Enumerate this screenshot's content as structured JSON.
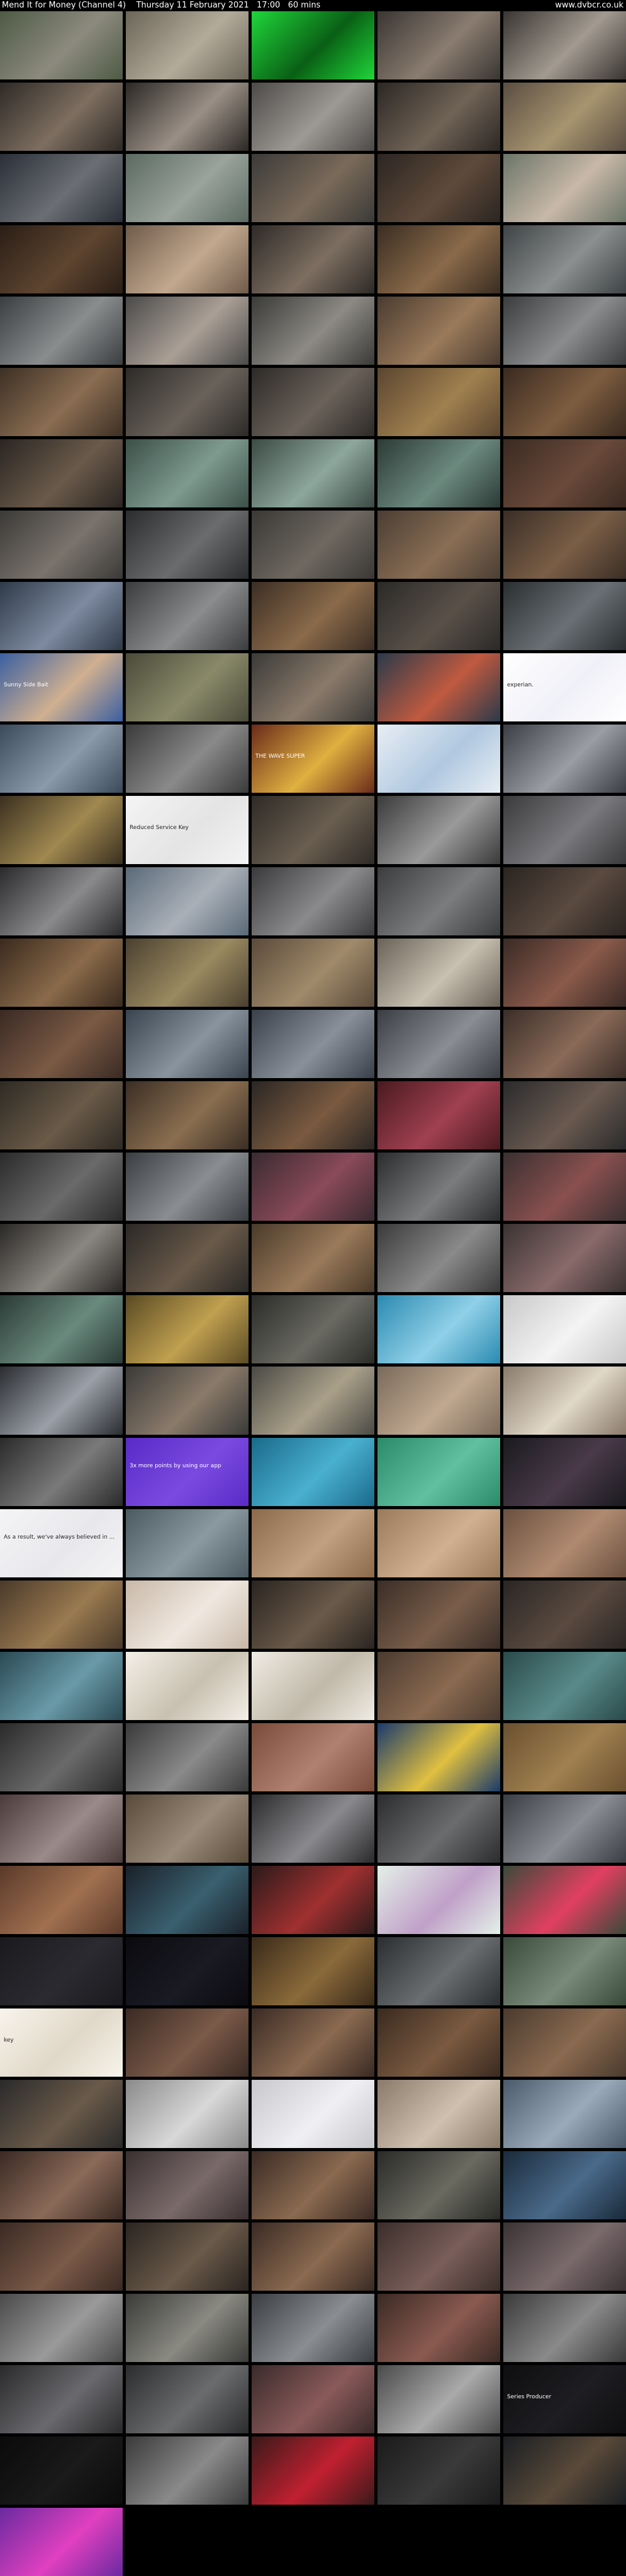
{
  "header": {
    "title": "Mend It for Money (Channel 4)",
    "date": "Thursday 11 February 2021",
    "time": "17:00",
    "duration": "60 mins",
    "site": "www.dvbcr.co.uk"
  },
  "thumbs": [
    {
      "c": [
        "#4e5a45",
        "#8c8a7e"
      ]
    },
    {
      "c": [
        "#6b6558",
        "#b3ab9a"
      ]
    },
    {
      "c": [
        "#1fd63a",
        "#0a5f15"
      ]
    },
    {
      "c": [
        "#3a3633",
        "#8a7c70"
      ]
    },
    {
      "c": [
        "#3a3532",
        "#a29a90"
      ]
    },
    {
      "c": [
        "#2f2a26",
        "#7d6e60"
      ]
    },
    {
      "c": [
        "#2b2824",
        "#9a8f86"
      ]
    },
    {
      "c": [
        "#4c4a48",
        "#9d9994"
      ]
    },
    {
      "c": [
        "#2c2724",
        "#706356"
      ]
    },
    {
      "c": [
        "#5a4e42",
        "#a7946f"
      ]
    },
    {
      "c": [
        "#2a2f38",
        "#6b6e73"
      ]
    },
    {
      "c": [
        "#5b6a62",
        "#9aa39c"
      ]
    },
    {
      "c": [
        "#3b3a38",
        "#7a6a5a"
      ]
    },
    {
      "c": [
        "#2b2522",
        "#5e4a3a"
      ]
    },
    {
      "c": [
        "#6b7569",
        "#c8b8a8"
      ]
    },
    {
      "c": [
        "#2a1e16",
        "#5e4530"
      ]
    },
    {
      "c": [
        "#6f5b4a",
        "#c2a88f"
      ]
    },
    {
      "c": [
        "#2e2a27",
        "#7d6e61"
      ]
    },
    {
      "c": [
        "#3a2d22",
        "#8a6a4a"
      ]
    },
    {
      "c": [
        "#3e4345",
        "#8c8f8f"
      ]
    },
    {
      "c": [
        "#3b3e40",
        "#8a8d8e"
      ]
    },
    {
      "c": [
        "#4a4a4a",
        "#aa9f95"
      ]
    },
    {
      "c": [
        "#3a3a38",
        "#8d8a84"
      ]
    },
    {
      "c": [
        "#4a3b30",
        "#9a7a5a"
      ]
    },
    {
      "c": [
        "#3a3c3e",
        "#8a8c8e"
      ]
    },
    {
      "c": [
        "#3d3025",
        "#8a6d52"
      ]
    },
    {
      "c": [
        "#2c2a28",
        "#6a625a"
      ]
    },
    {
      "c": [
        "#2d2a27",
        "#6b625a"
      ]
    },
    {
      "c": [
        "#5a4530",
        "#a0804f"
      ]
    },
    {
      "c": [
        "#3a2a20",
        "#7d5d40"
      ]
    },
    {
      "c": [
        "#2a2522",
        "#6a5a4a"
      ]
    },
    {
      "c": [
        "#3b5048",
        "#7e9a8f"
      ]
    },
    {
      "c": [
        "#3b4a44",
        "#8da79c"
      ]
    },
    {
      "c": [
        "#2c3a35",
        "#6c8a7f"
      ]
    },
    {
      "c": [
        "#3a2a22",
        "#6a4a3a"
      ]
    },
    {
      "c": [
        "#3b3a38",
        "#7a736c"
      ]
    },
    {
      "c": [
        "#2a2c2e",
        "#6a6c6e"
      ]
    },
    {
      "c": [
        "#3a3835",
        "#6e6860"
      ]
    },
    {
      "c": [
        "#4a3e33",
        "#8a6e55"
      ]
    },
    {
      "c": [
        "#3a2e26",
        "#7a5e46"
      ]
    },
    {
      "c": [
        "#2f3a48",
        "#7d8aa0"
      ]
    },
    {
      "c": [
        "#3a3c3e",
        "#8a8c8e"
      ]
    },
    {
      "c": [
        "#3b2e24",
        "#8a6a4a"
      ]
    },
    {
      "c": [
        "#2a2a28",
        "#5a5048"
      ]
    },
    {
      "c": [
        "#2a2e30",
        "#6a7075"
      ]
    },
    {
      "c": [
        "#3a5fa0",
        "#d0b090"
      ],
      "cap": "Sunny Side Bait"
    },
    {
      "c": [
        "#4a4a3a",
        "#8a8a6a"
      ]
    },
    {
      "c": [
        "#3a3a38",
        "#8a7a6a"
      ]
    },
    {
      "c": [
        "#2a3a4a",
        "#c05a40"
      ]
    },
    {
      "c": [
        "#ffffff",
        "#f0f0f8"
      ],
      "cap": "experian."
    },
    {
      "c": [
        "#3a4a5a",
        "#8a9aaa"
      ]
    },
    {
      "c": [
        "#3a3a3a",
        "#8a8a8a"
      ]
    },
    {
      "c": [
        "#6a2a1a",
        "#e0b040"
      ],
      "cap": "THE WAVE SUPER"
    },
    {
      "c": [
        "#e8eef4",
        "#b0c8e0"
      ]
    },
    {
      "c": [
        "#3a3e44",
        "#9a9ea4"
      ]
    },
    {
      "c": [
        "#3a3020",
        "#a08850"
      ]
    },
    {
      "c": [
        "#f4f4f4",
        "#e4e4e4"
      ],
      "cap": "Reduced Service Key"
    },
    {
      "c": [
        "#2e2a26",
        "#6a5e50"
      ]
    },
    {
      "c": [
        "#3a3a3a",
        "#9a9a9a"
      ]
    },
    {
      "c": [
        "#3a3a3c",
        "#7a7a7e"
      ]
    },
    {
      "c": [
        "#2a2a2c",
        "#8a8a8c"
      ]
    },
    {
      "c": [
        "#5a6a78",
        "#aab0b8"
      ]
    },
    {
      "c": [
        "#3a3a3c",
        "#8a8a8c"
      ]
    },
    {
      "c": [
        "#3a3c3e",
        "#7a7c7e"
      ]
    },
    {
      "c": [
        "#2a2420",
        "#5a4a40"
      ]
    },
    {
      "c": [
        "#3a2a1e",
        "#8a6a4a"
      ]
    },
    {
      "c": [
        "#4a4030",
        "#9a8a60"
      ]
    },
    {
      "c": [
        "#5a4a3a",
        "#a08a6a"
      ]
    },
    {
      "c": [
        "#6a6258",
        "#c8c0b0"
      ]
    },
    {
      "c": [
        "#3a2a26",
        "#8a5a4a"
      ]
    },
    {
      "c": [
        "#3a2a24",
        "#7a5a44"
      ]
    },
    {
      "c": [
        "#3a4450",
        "#8a949e"
      ]
    },
    {
      "c": [
        "#3a404a",
        "#8a909a"
      ]
    },
    {
      "c": [
        "#3a3e44",
        "#8a8e94"
      ]
    },
    {
      "c": [
        "#3a2e28",
        "#8a6a58"
      ]
    },
    {
      "c": [
        "#2e2a24",
        "#6a5a48"
      ]
    },
    {
      "c": [
        "#3a2e24",
        "#8a6e50"
      ]
    },
    {
      "c": [
        "#2a2624",
        "#7a5a40"
      ]
    },
    {
      "c": [
        "#4a1a20",
        "#a04050"
      ]
    },
    {
      "c": [
        "#2a2a2c",
        "#6a5a50"
      ]
    },
    {
      "c": [
        "#2a2a2a",
        "#6a6a6a"
      ]
    },
    {
      "c": [
        "#3a3e42",
        "#8a8e92"
      ]
    },
    {
      "c": [
        "#3a2a30",
        "#8a4a5a"
      ]
    },
    {
      "c": [
        "#2a2c2e",
        "#7a7c7e"
      ]
    },
    {
      "c": [
        "#3a3030",
        "#8a5050"
      ]
    },
    {
      "c": [
        "#2a2826",
        "#8a8680"
      ]
    },
    {
      "c": [
        "#2a2826",
        "#6a5a4a"
      ]
    },
    {
      "c": [
        "#4a3a2a",
        "#9a7a5a"
      ]
    },
    {
      "c": [
        "#3a3a3a",
        "#8a8a8a"
      ]
    },
    {
      "c": [
        "#3a3232",
        "#8a6a6a"
      ]
    },
    {
      "c": [
        "#2a3a34",
        "#6a8a7e"
      ]
    },
    {
      "c": [
        "#5a4a24",
        "#c0a050"
      ]
    },
    {
      "c": [
        "#2a2a28",
        "#6a6a62"
      ]
    },
    {
      "c": [
        "#2a8ab0",
        "#90d0e8"
      ]
    },
    {
      "c": [
        "#c8c8c8",
        "#f4f4f4"
      ]
    },
    {
      "c": [
        "#2a2c30",
        "#9aa0a8"
      ]
    },
    {
      "c": [
        "#3a3a38",
        "#8a7a6a"
      ]
    },
    {
      "c": [
        "#4a4a44",
        "#aaa08a"
      ]
    },
    {
      "c": [
        "#7a6a5a",
        "#c0a890"
      ]
    },
    {
      "c": [
        "#8a7a6a",
        "#e0d8c8"
      ]
    },
    {
      "c": [
        "#2a2a2a",
        "#7a7a7a"
      ]
    },
    {
      "c": [
        "#5a2ac8",
        "#7a4ae0"
      ],
      "cap": "3x more points by using our app"
    },
    {
      "c": [
        "#1a6a8a",
        "#4ab0d0"
      ]
    },
    {
      "c": [
        "#2a8a6a",
        "#60c0a0"
      ]
    },
    {
      "c": [
        "#1a1a1e",
        "#4a3a4a"
      ]
    },
    {
      "c": [
        "#f4f4f6",
        "#e8e8ec"
      ],
      "cap": "As a result, we've always believed in ..."
    },
    {
      "c": [
        "#4a5a60",
        "#8a9aa0"
      ]
    },
    {
      "c": [
        "#8a6a4a",
        "#c0a080"
      ]
    },
    {
      "c": [
        "#9a7a5a",
        "#d0b090"
      ]
    },
    {
      "c": [
        "#6a5040",
        "#b08a70"
      ]
    },
    {
      "c": [
        "#4a3a2a",
        "#9a7a50"
      ]
    },
    {
      "c": [
        "#c8b8a8",
        "#f0e8e0"
      ]
    },
    {
      "c": [
        "#2a2420",
        "#6a5a4a"
      ]
    },
    {
      "c": [
        "#3a2e28",
        "#7a5e4a"
      ]
    },
    {
      "c": [
        "#2a2624",
        "#5a4a40"
      ]
    },
    {
      "c": [
        "#2a4a54",
        "#6a9aa8"
      ]
    },
    {
      "c": [
        "#f4f0e8",
        "#c8c0b0"
      ]
    },
    {
      "c": [
        "#f0ece4",
        "#c0b8a8"
      ]
    },
    {
      "c": [
        "#4a3a30",
        "#8a6a50"
      ]
    },
    {
      "c": [
        "#2a4a4a",
        "#5a8a8a"
      ]
    },
    {
      "c": [
        "#2a2a2a",
        "#6a6a6a"
      ]
    },
    {
      "c": [
        "#3a3a3a",
        "#8a8a8a"
      ]
    },
    {
      "c": [
        "#7a4a3a",
        "#b08070"
      ]
    },
    {
      "c": [
        "#1a3a6a",
        "#e0c040"
      ]
    },
    {
      "c": [
        "#6a5030",
        "#a08050"
      ]
    },
    {
      "c": [
        "#4a3a3a",
        "#9a8a8a"
      ]
    },
    {
      "c": [
        "#5a4a3a",
        "#9a8a7a"
      ]
    },
    {
      "c": [
        "#2a2a2c",
        "#8a8a8e"
      ]
    },
    {
      "c": [
        "#2a2c2e",
        "#6a6c6e"
      ]
    },
    {
      "c": [
        "#3a3e44",
        "#8a8e94"
      ]
    },
    {
      "c": [
        "#5a3a2a",
        "#a07050"
      ]
    },
    {
      "c": [
        "#1a2028",
        "#3a6070"
      ]
    },
    {
      "c": [
        "#2a1a1a",
        "#a03030"
      ]
    },
    {
      "c": [
        "#e4f0e8",
        "#c0a0c8"
      ]
    },
    {
      "c": [
        "#3a4a3a",
        "#e04060"
      ]
    },
    {
      "c": [
        "#1a1a1e",
        "#2a2a30"
      ]
    },
    {
      "c": [
        "#0a0a0e",
        "#1a1a24"
      ]
    },
    {
      "c": [
        "#3a2a1a",
        "#8a6a3a"
      ]
    },
    {
      "c": [
        "#2a2e30",
        "#6a6e70"
      ]
    },
    {
      "c": [
        "#3a4a3a",
        "#7a8a7a"
      ]
    },
    {
      "c": [
        "#f8f4ec",
        "#e0d8c8"
      ],
      "cap": "key"
    },
    {
      "c": [
        "#3a2a24",
        "#7a5a48"
      ]
    },
    {
      "c": [
        "#3a2a24",
        "#8a6a50"
      ]
    },
    {
      "c": [
        "#3a2a20",
        "#7a5a40"
      ]
    },
    {
      "c": [
        "#4a3a2e",
        "#8a6a50"
      ]
    },
    {
      "c": [
        "#2a2a2a",
        "#6a5a4a"
      ]
    },
    {
      "c": [
        "#8a8a8a",
        "#d8d8d8"
      ]
    },
    {
      "c": [
        "#c8c8cc",
        "#f0f0f4"
      ]
    },
    {
      "c": [
        "#8a7a6a",
        "#d0c0b0"
      ]
    },
    {
      "c": [
        "#4a5a6a",
        "#9aaaba"
      ]
    },
    {
      "c": [
        "#3a2a24",
        "#8a6a58"
      ]
    },
    {
      "c": [
        "#3a3030",
        "#7a6a6a"
      ]
    },
    {
      "c": [
        "#3a2a24",
        "#8a6a50"
      ]
    },
    {
      "c": [
        "#2a2a28",
        "#6a6a60"
      ]
    },
    {
      "c": [
        "#1a2a3a",
        "#4a6a8a"
      ]
    },
    {
      "c": [
        "#3a2a24",
        "#7a5a48"
      ]
    },
    {
      "c": [
        "#2a2420",
        "#6a5a4a"
      ]
    },
    {
      "c": [
        "#3a2a24",
        "#8a6a50"
      ]
    },
    {
      "c": [
        "#3a2e2a",
        "#7a5e5a"
      ]
    },
    {
      "c": [
        "#3a3234",
        "#7a6a6c"
      ]
    },
    {
      "c": [
        "#4a4a4a",
        "#9a9a9a"
      ]
    },
    {
      "c": [
        "#3a3a38",
        "#8a8a82"
      ]
    },
    {
      "c": [
        "#3a3e42",
        "#8a8e92"
      ]
    },
    {
      "c": [
        "#3a2a24",
        "#8a5a50"
      ]
    },
    {
      "c": [
        "#3a3a3a",
        "#8a8a8a"
      ]
    },
    {
      "c": [
        "#2a2a2c",
        "#6a6a6e"
      ]
    },
    {
      "c": [
        "#2a2c2e",
        "#6a6c6e"
      ]
    },
    {
      "c": [
        "#3a2a2a",
        "#8a5a5a"
      ]
    },
    {
      "c": [
        "#4a4a4a",
        "#aaaaaa"
      ]
    },
    {
      "c": [
        "#0e0e10",
        "#1e1e22"
      ],
      "cap": "Series Producer"
    },
    {
      "c": [
        "#0a0a0a",
        "#1a1a1a"
      ]
    },
    {
      "c": [
        "#3a3a3a",
        "#8a8a8a"
      ]
    },
    {
      "c": [
        "#3a1a1a",
        "#c02030"
      ]
    },
    {
      "c": [
        "#1a1a1a",
        "#3a3a3a"
      ]
    },
    {
      "c": [
        "#1a1e22",
        "#5a4a3a"
      ]
    },
    {
      "c": [
        "#6a2aa0",
        "#e040c0"
      ]
    }
  ]
}
